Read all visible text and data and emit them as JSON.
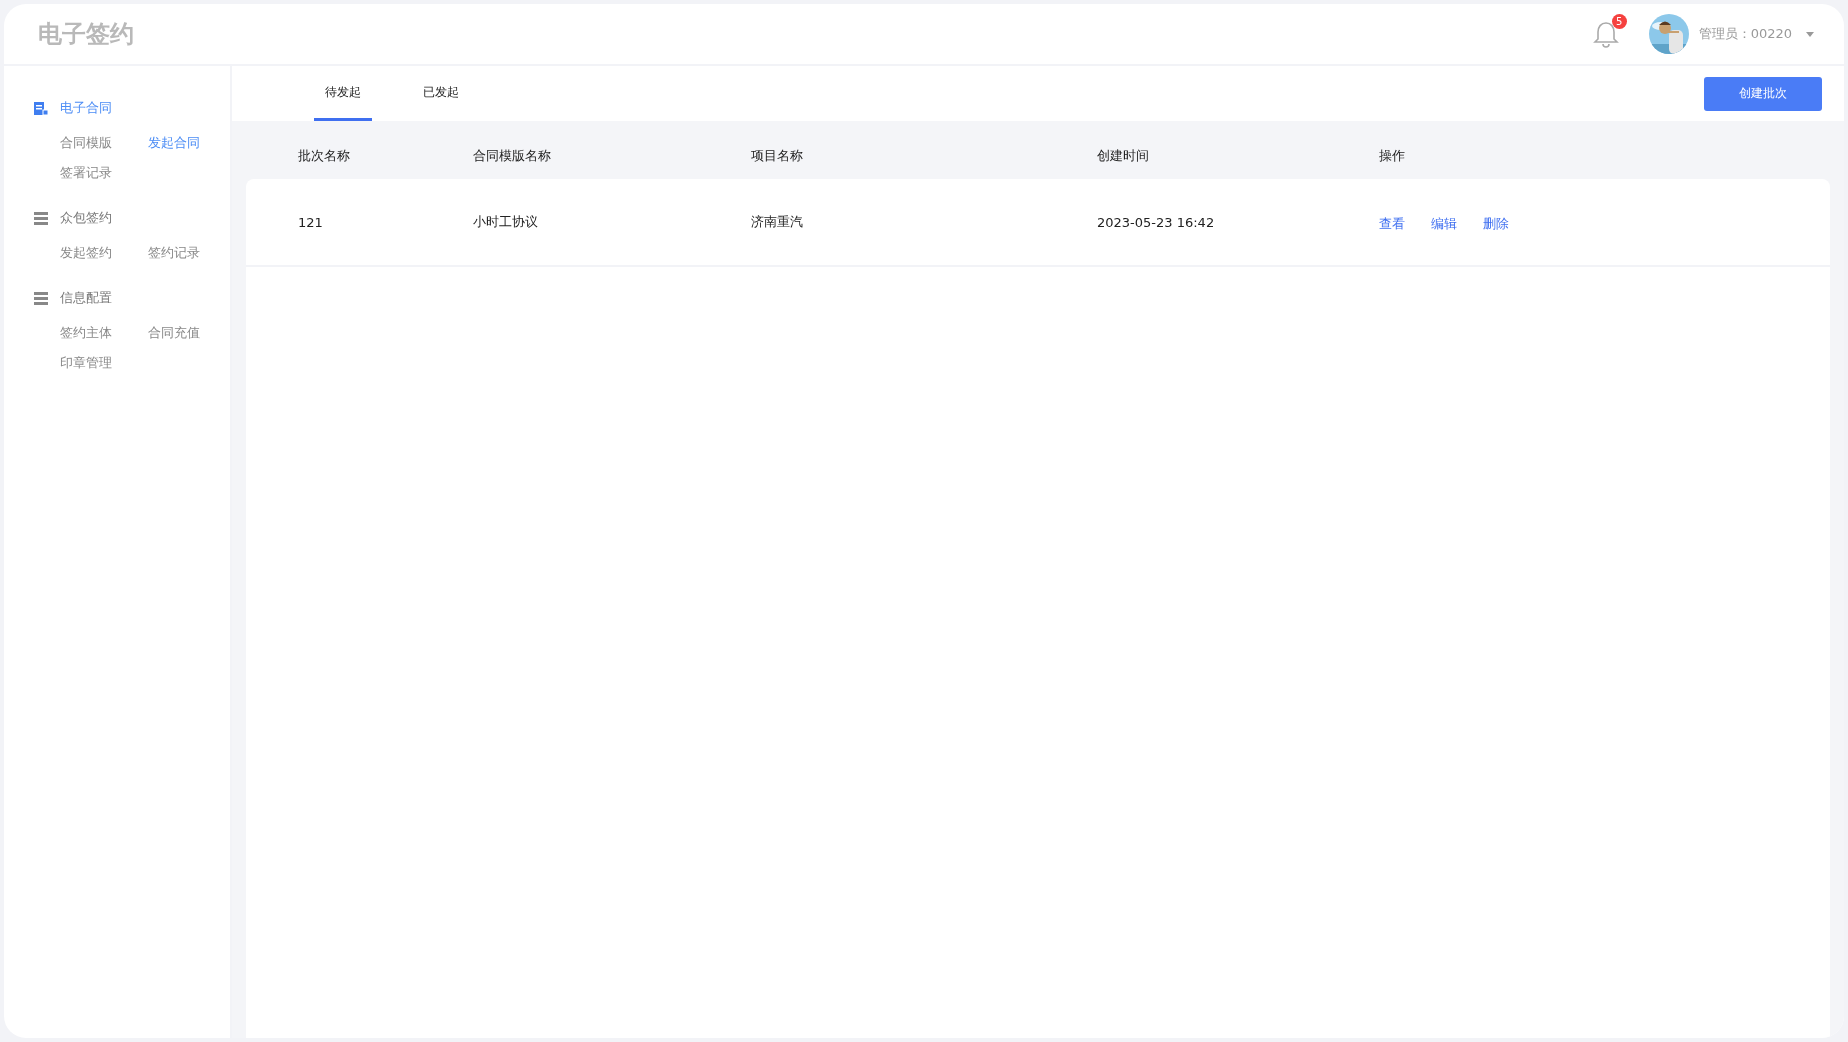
{
  "header": {
    "logo": "电子签约",
    "notifications": "5",
    "user": "管理员：00220"
  },
  "sidebar": {
    "groups": [
      {
        "title": "电子合同",
        "selected": true,
        "items": [
          {
            "label": "合同模版",
            "selected": false
          },
          {
            "label": "发起合同",
            "selected": true
          },
          {
            "label": "签署记录",
            "selected": false
          }
        ]
      },
      {
        "title": "众包签约",
        "selected": false,
        "items": [
          {
            "label": "发起签约",
            "selected": false
          },
          {
            "label": "签约记录",
            "selected": false
          }
        ]
      },
      {
        "title": "信息配置",
        "selected": false,
        "items": [
          {
            "label": "签约主体",
            "selected": false
          },
          {
            "label": "合同充值",
            "selected": false
          },
          {
            "label": "印章管理",
            "selected": false
          }
        ]
      }
    ]
  },
  "tabs": [
    {
      "label": "待发起",
      "selected": true
    },
    {
      "label": "已发起",
      "selected": false
    }
  ],
  "create_button": "创建批次",
  "table": {
    "columns": [
      "批次名称",
      "合同模版名称",
      "项目名称",
      "创建时间",
      "操作"
    ],
    "rows": [
      {
        "cells": [
          "121",
          "小时工协议",
          "济南重汽",
          "2023-05-23 16:42"
        ],
        "actions": [
          "查看",
          "编辑",
          "删除"
        ]
      }
    ]
  }
}
